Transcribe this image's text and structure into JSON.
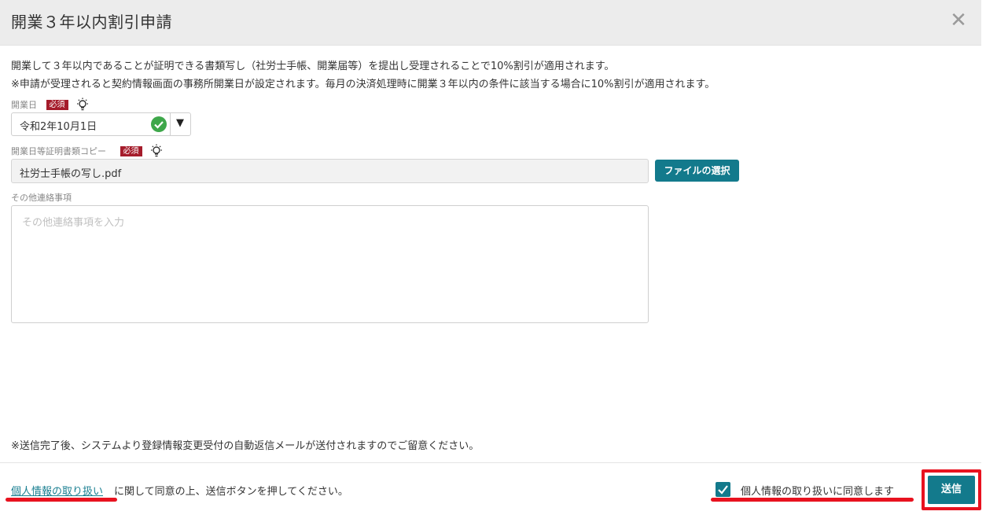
{
  "dialog": {
    "title": "開業３年以内割引申請",
    "close_icon": "close-icon"
  },
  "description": {
    "line1": "開業して３年以内であることが証明できる書類写し（社労士手帳、開業届等）を提出し受理されることで10%割引が適用されます。",
    "line2": "※申請が受理されると契約情報画面の事務所開業日が設定されます。毎月の決済処理時に開業３年以内の条件に該当する場合に10%割引が適用されます。"
  },
  "fields": {
    "opening_date": {
      "label": "開業日",
      "required_badge": "必須",
      "value": "令和2年10月1日"
    },
    "proof_copy": {
      "label": "開業日等証明書類コピー",
      "required_badge": "必須",
      "value": "社労士手帳の写し.pdf",
      "button_label": "ファイルの選択"
    },
    "other_notes": {
      "label": "その他連絡事項",
      "placeholder": "その他連絡事項を入力"
    }
  },
  "note": "※送信完了後、システムより登録情報変更受付の自動返信メールが送付されますのでご留意ください。",
  "footer": {
    "privacy_link": "個人情報の取り扱い",
    "privacy_text": "に関して同意の上、送信ボタンを押してください。",
    "agree_label": "個人情報の取り扱いに同意します",
    "agree_checked": true,
    "send_label": "送信"
  },
  "colors": {
    "accent": "#137a8c",
    "required": "#a51c2b",
    "highlight": "#e8121f",
    "valid": "#3ea74a"
  }
}
